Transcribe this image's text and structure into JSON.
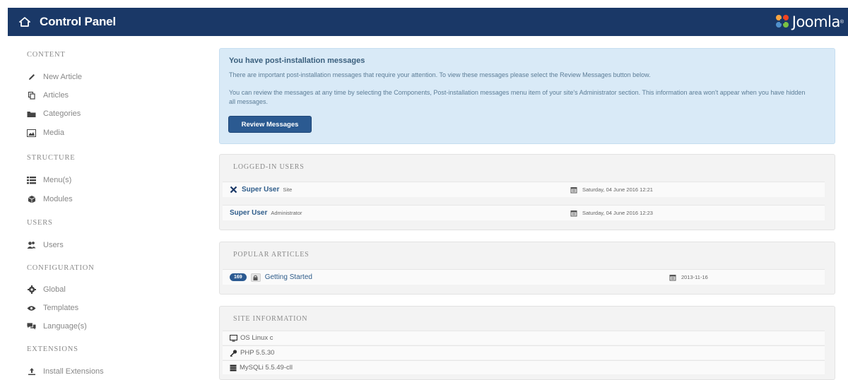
{
  "header": {
    "title": "Control Panel",
    "home_icon": "home-icon",
    "brand": "Joomla",
    "brand_mark": "®",
    "colors": {
      "bar": "#1a3867",
      "brand_logo": [
        "#f9a541",
        "#f44321",
        "#5091cd",
        "#7ac143"
      ]
    }
  },
  "sidebar": {
    "sections": [
      {
        "title": "CONTENT",
        "items": [
          {
            "label": "New Article",
            "icon": "pencil-icon"
          },
          {
            "label": "Articles",
            "icon": "copy-icon"
          },
          {
            "label": "Categories",
            "icon": "folder-icon"
          },
          {
            "label": "Media",
            "icon": "image-icon"
          }
        ]
      },
      {
        "title": "STRUCTURE",
        "items": [
          {
            "label": "Menu(s)",
            "icon": "list-icon"
          },
          {
            "label": "Modules",
            "icon": "cube-icon"
          }
        ]
      },
      {
        "title": "USERS",
        "items": [
          {
            "label": "Users",
            "icon": "users-icon"
          }
        ]
      },
      {
        "title": "CONFIGURATION",
        "items": [
          {
            "label": "Global",
            "icon": "gear-icon"
          },
          {
            "label": "Templates",
            "icon": "eye-icon"
          },
          {
            "label": "Language(s)",
            "icon": "comments-icon"
          }
        ]
      },
      {
        "title": "EXTENSIONS",
        "items": [
          {
            "label": "Install Extensions",
            "icon": "upload-icon"
          }
        ]
      }
    ]
  },
  "alert": {
    "title": "You have post-installation messages",
    "p1": "There are important post-installation messages that require your attention. To view these messages please select the Review Messages button below.",
    "p2": "You can review the messages at any time by selecting the Components, Post-installation messages menu item of your site's Administrator section. This information area won't appear when you have hidden all messages.",
    "button": "Review Messages"
  },
  "logged_users": {
    "heading": "LOGGED-IN USERS",
    "rows": [
      {
        "name": "Super User",
        "client": "Site",
        "date": "Saturday, 04 June 2016 12:21",
        "icon": "close-icon"
      },
      {
        "name": "Super User",
        "client": "Administrator",
        "date": "Saturday, 04 June 2016 12:23"
      }
    ]
  },
  "popular": {
    "heading": "POPULAR ARTICLES",
    "rows": [
      {
        "hits": "169",
        "title": "Getting Started",
        "date": "2013-11-16",
        "icon": "lock-icon"
      }
    ]
  },
  "site_info": {
    "heading": "SITE INFORMATION",
    "rows": [
      {
        "text": "OS Linux c",
        "icon": "monitor-icon"
      },
      {
        "text": "PHP 5.5.30",
        "icon": "key-icon"
      },
      {
        "text": "MySQLi 5.5.49-cll",
        "icon": "database-icon"
      }
    ]
  }
}
